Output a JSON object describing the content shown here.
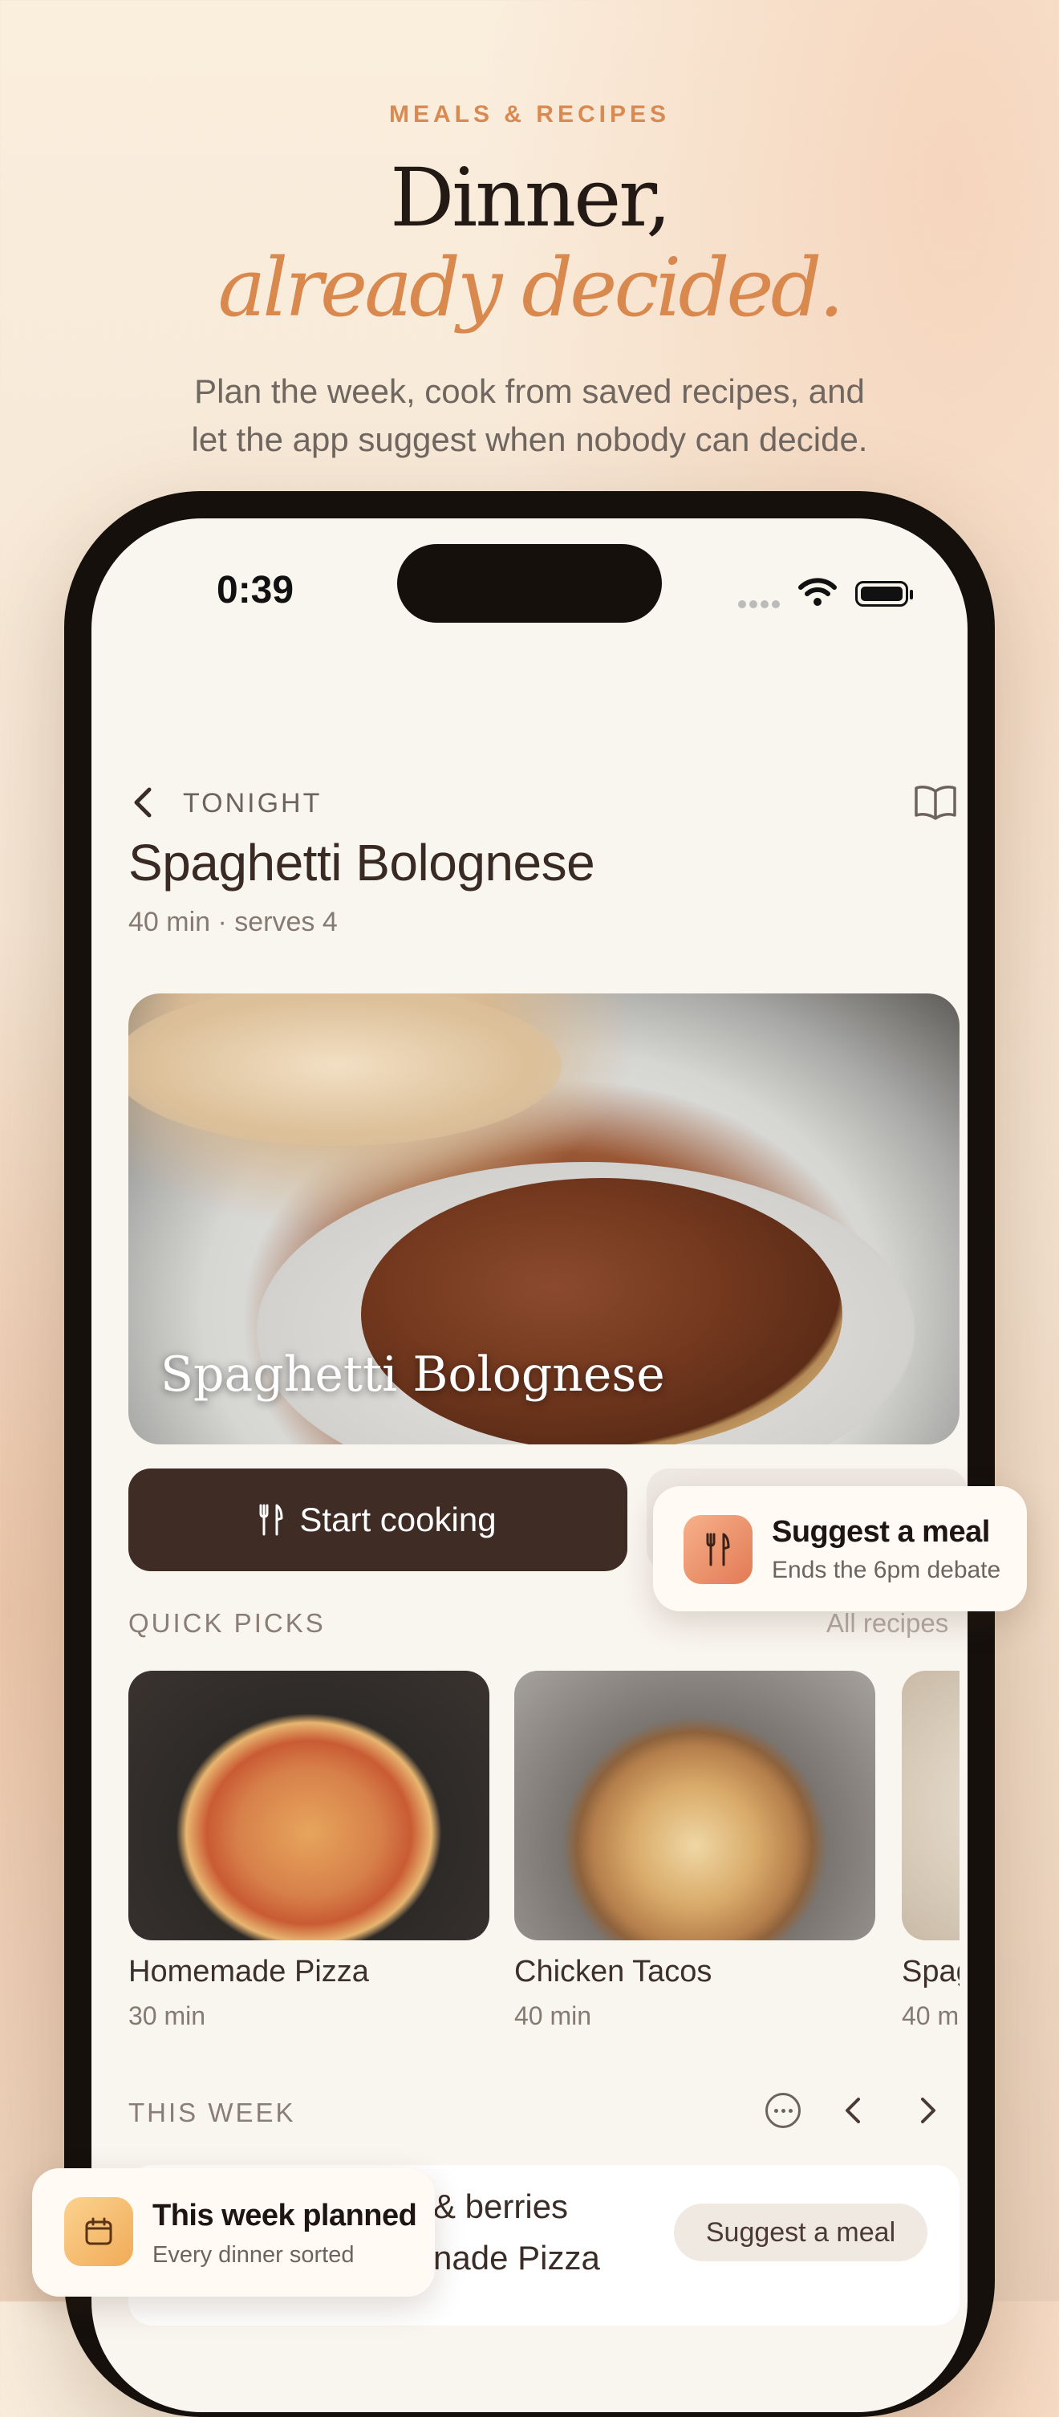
{
  "hero": {
    "eyebrow": "MEALS & RECIPES",
    "headline_1": "Dinner,",
    "headline_2": "already decided.",
    "subtitle_line_1": "Plan the week, cook from saved recipes, and",
    "subtitle_line_2": "let the app suggest when nobody can decide."
  },
  "status_bar": {
    "time": "0:39"
  },
  "header": {
    "eyebrow": "TONIGHT",
    "title": "Spaghetti Bolognese",
    "meta": "40 min · serves 4"
  },
  "hero_photo": {
    "caption": "Spaghetti Bolognese"
  },
  "actions": {
    "start_cooking": "Start cooking"
  },
  "toast_suggest": {
    "title": "Suggest a meal",
    "subtitle": "Ends the 6pm debate"
  },
  "quick_picks": {
    "label": "QUICK PICKS",
    "link": "All recipes",
    "items": [
      {
        "name": "Homemade Pizza",
        "duration": "30 min"
      },
      {
        "name": "Chicken Tacos",
        "duration": "40 min"
      },
      {
        "name": "Spag",
        "duration": "40 m"
      }
    ]
  },
  "this_week": {
    "label": "THIS WEEK",
    "line_1": "& berries",
    "line_2": "nade Pizza",
    "suggest_button": "Suggest a meal"
  },
  "toast_week": {
    "title": "This week planned",
    "subtitle": "Every dinner sorted"
  },
  "colors": {
    "accent": "#d9884e",
    "primary_button": "#3f2c25",
    "background": "#f9f5ef"
  }
}
